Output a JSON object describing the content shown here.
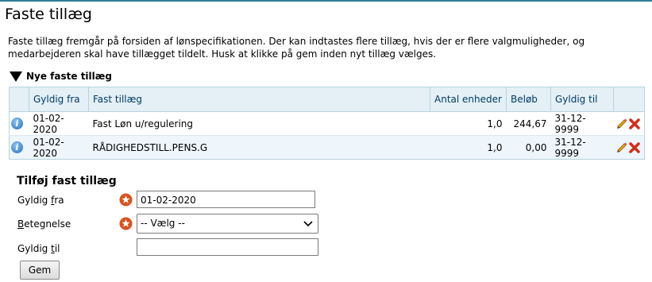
{
  "page": {
    "title": "Faste tillæg",
    "intro_line1": "Faste tillæg fremgår på forsiden af lønspecifikationen. Der kan indtastes flere tillæg, hvis der er flere valgmuligheder, og",
    "intro_line2": "medarbejderen skal have tillægget tildelt. Husk at klikke på gem inden nyt tillæg vælges."
  },
  "section": {
    "title": "Nye faste tillæg"
  },
  "table": {
    "columns": [
      "Gyldig fra",
      "Fast tillæg",
      "Antal enheder",
      "Beløb",
      "Gyldig til"
    ],
    "rows": [
      {
        "from": "01-02-2020",
        "name": "Fast Løn u/regulering",
        "units": "1,0",
        "amount": "244,67",
        "to": "31-12-9999"
      },
      {
        "from": "01-02-2020",
        "name": "RÅDIGHEDSTILL.PENS.G",
        "units": "1,0",
        "amount": "0,00",
        "to": "31-12-9999"
      }
    ],
    "info_glyph": "i"
  },
  "form": {
    "title": "Tilføj fast tillæg",
    "from_label_pre": "Gyldig ",
    "from_label_key": "f",
    "from_label_post": "ra",
    "from_value": "01-02-2020",
    "type_label_key": "B",
    "type_label_post": "etegnelse",
    "type_value": "-- Vælg --",
    "to_label_pre": "Gyldig ",
    "to_label_key": "t",
    "to_label_post": "il",
    "to_value": "",
    "save_label": "Gem"
  },
  "icons": {
    "info": "info-icon",
    "edit": "pencil-icon",
    "delete": "red-x-icon",
    "required": "required-star-icon",
    "dropdown": "chevron-down-icon"
  },
  "colors": {
    "header_bg": "#e4f0f6",
    "header_text": "#003a66",
    "alt_row_bg": "#eef5fb",
    "border": "#b7d3dd",
    "required": "#d9531e",
    "delete": "#d62c1a"
  }
}
